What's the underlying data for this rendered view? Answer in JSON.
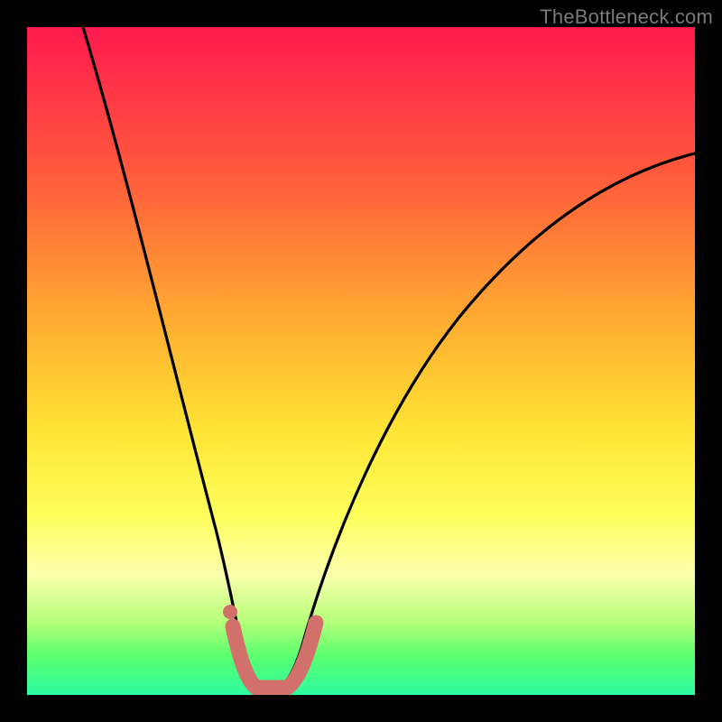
{
  "watermark": "TheBottleneck.com",
  "chart_data": {
    "type": "line",
    "title": "",
    "xlabel": "",
    "ylabel": "",
    "xlim": [
      0,
      100
    ],
    "ylim": [
      0,
      100
    ],
    "series": [
      {
        "name": "bottleneck-curve",
        "x": [
          8,
          10,
          12,
          14,
          16,
          18,
          20,
          22,
          24,
          26,
          28,
          30,
          31,
          32,
          33,
          34,
          35,
          36,
          38,
          42,
          46,
          50,
          55,
          60,
          65,
          70,
          75,
          80,
          85,
          90,
          95,
          100
        ],
        "y": [
          100,
          93,
          86,
          79,
          72,
          65,
          58,
          51,
          44,
          37,
          30,
          17,
          10,
          5,
          2,
          0,
          0,
          0,
          2,
          10,
          22,
          32,
          42,
          50,
          56,
          61,
          65,
          68,
          71,
          73,
          75,
          77
        ]
      },
      {
        "name": "highlight-band",
        "x": [
          29.5,
          30.5,
          31.5,
          32.5,
          33.5,
          34.5,
          35.5,
          36.5,
          37.5,
          38.5,
          39.5,
          40.5
        ],
        "y": [
          11,
          7,
          4,
          2,
          1,
          1,
          1,
          1.5,
          2.5,
          4,
          6,
          9
        ]
      }
    ],
    "highlight_dot": {
      "x": 29.5,
      "y": 12
    },
    "colors": {
      "curve": "#000000",
      "highlight": "#d2706b",
      "background_top": "#ff1a4d",
      "background_bottom": "#2dfca0"
    }
  }
}
